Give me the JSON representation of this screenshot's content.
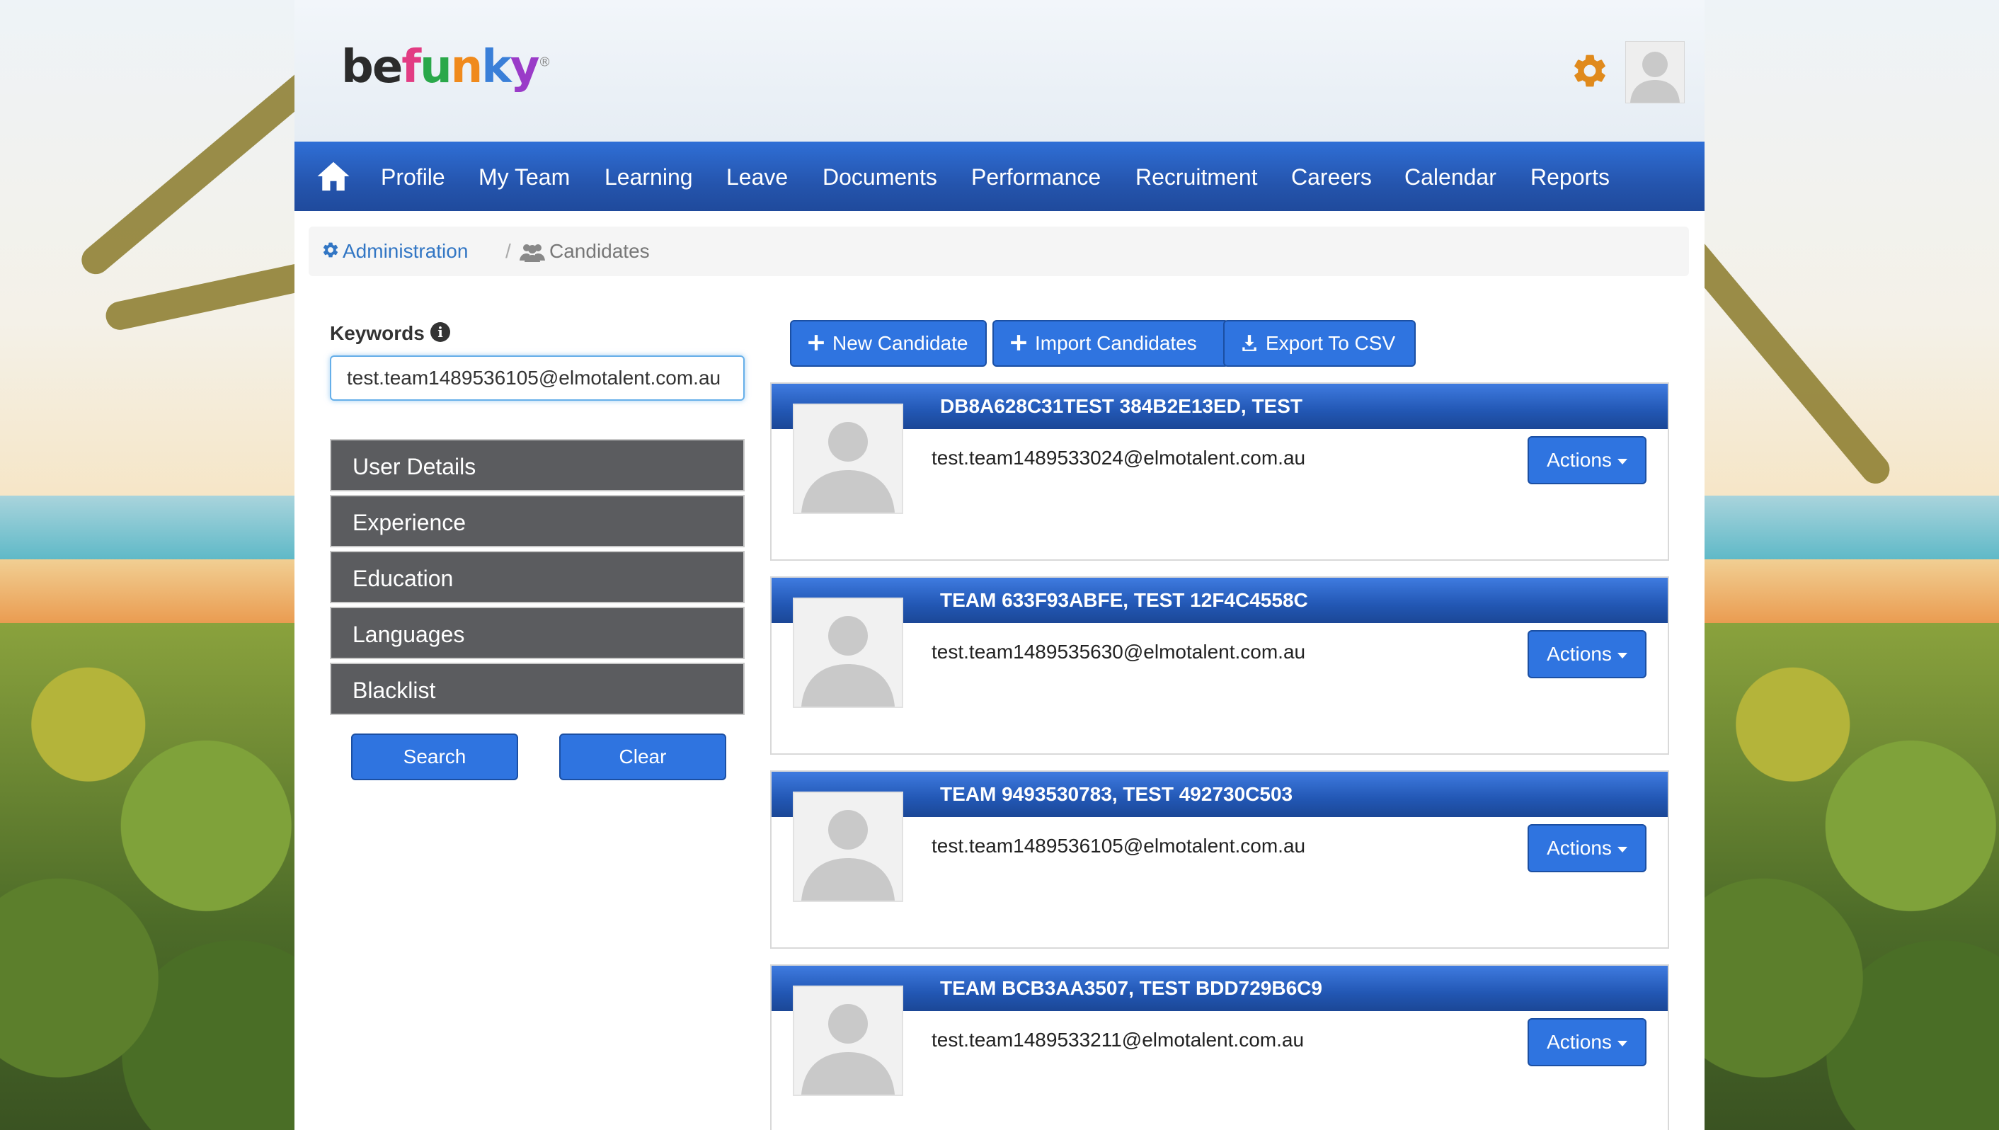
{
  "brand": {
    "logo_text": "befunky"
  },
  "header": {
    "settings_icon": "gear-icon",
    "avatar_icon": "user-avatar-icon",
    "accent": "#e08a1c"
  },
  "nav": {
    "home_icon": "home-icon",
    "items": [
      {
        "label": "Profile"
      },
      {
        "label": "My Team"
      },
      {
        "label": "Learning"
      },
      {
        "label": "Leave"
      },
      {
        "label": "Documents"
      },
      {
        "label": "Performance"
      },
      {
        "label": "Recruitment"
      },
      {
        "label": "Careers"
      },
      {
        "label": "Calendar"
      },
      {
        "label": "Reports"
      }
    ]
  },
  "breadcrumb": {
    "admin": "Administration",
    "separator": "/",
    "current": "Candidates"
  },
  "search": {
    "label": "Keywords",
    "value": "test.team1489536105@elmotalent.com.au",
    "filters": [
      "User Details",
      "Experience",
      "Education",
      "Languages",
      "Blacklist"
    ],
    "search_label": "Search",
    "clear_label": "Clear"
  },
  "toolbar": {
    "new_label": "New Candidate",
    "import_label": "Import Candidates",
    "export_label": "Export To CSV"
  },
  "candidates": [
    {
      "name": "DB8A628C31TEST 384B2E13ED, TEST",
      "email": "test.team1489533024@elmotalent.com.au",
      "actions_label": "Actions"
    },
    {
      "name": "TEAM 633F93ABFE, TEST 12F4C4558C",
      "email": "test.team1489535630@elmotalent.com.au",
      "actions_label": "Actions"
    },
    {
      "name": "TEAM 9493530783, TEST 492730C503",
      "email": "test.team1489536105@elmotalent.com.au",
      "actions_label": "Actions"
    },
    {
      "name": "TEAM BCB3AA3507, TEST BDD729B6C9",
      "email": "test.team1489533211@elmotalent.com.au",
      "actions_label": "Actions"
    }
  ],
  "colors": {
    "primary": "#2f74e0",
    "nav": "#2555ae",
    "filter_bg": "#5b5c5f",
    "link": "#3276c4"
  }
}
